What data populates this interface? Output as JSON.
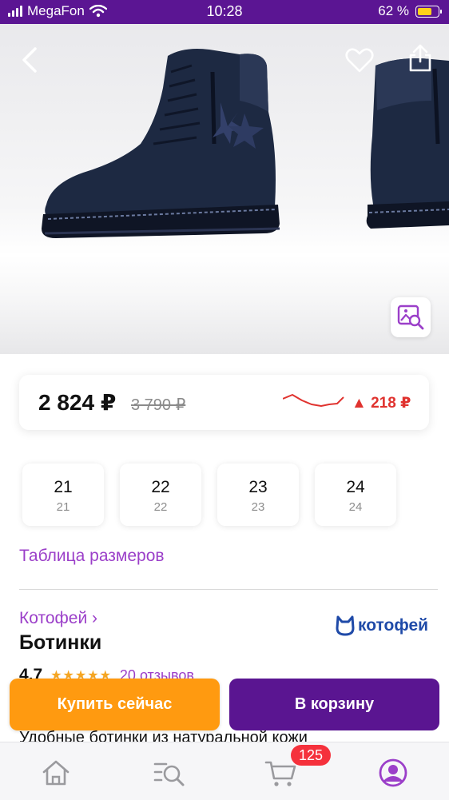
{
  "status_bar": {
    "carrier": "MegaFon",
    "time": "10:28",
    "battery": "62 %"
  },
  "product": {
    "price_now": "2 824 ₽",
    "price_old": "3 790 ₽",
    "price_change": "▲ 218 ₽",
    "brand": "Котофей ›",
    "brand_logo_text": "котофей",
    "title": "Ботинки",
    "rating": "4,7",
    "stars": "★★★★★",
    "reviews": "20 отзывов",
    "description": "Удобные ботинки из натуральной кожи"
  },
  "sizes": [
    {
      "main": "21",
      "sub": "21"
    },
    {
      "main": "22",
      "sub": "22"
    },
    {
      "main": "23",
      "sub": "23"
    },
    {
      "main": "24",
      "sub": "24"
    }
  ],
  "links": {
    "size_table": "Таблица размеров"
  },
  "actions": {
    "buy_now": "Купить сейчас",
    "add_to_cart": "В корзину"
  },
  "tabbar": {
    "cart_count": "125",
    "items": [
      "home-icon",
      "catalog-search-icon",
      "cart-icon",
      "profile-icon"
    ]
  },
  "colors": {
    "brand_purple": "#5a1591",
    "link_purple": "#9b3fc9",
    "buy_orange": "#ff9a10",
    "price_up_red": "#e0332f",
    "badge_red": "#f5313c"
  }
}
